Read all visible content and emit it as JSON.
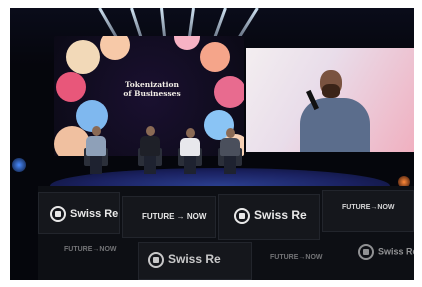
{
  "scene": {
    "screen_title_line1": "Tokenization",
    "screen_title_line2": "of Businesses",
    "banner_brand_1": "Swiss Re",
    "banner_slogan_1": "FUTURE → NOW",
    "banner_brand_2": "Swiss Re",
    "banner_slogan_2": "FUTURE→NOW",
    "banner_brand_3": "Swiss Re",
    "banner_slogan_3": "FUTURE→NOW",
    "banner_brand_4": "Swiss Re",
    "banner_slogan_4": "FUTURE→NOW",
    "banner_brand_5": "Swiss Re"
  },
  "colors": {
    "stage_blue": "#2b3f8f",
    "screen_pink": "#f0b0c0",
    "beam": "#dcefff"
  }
}
